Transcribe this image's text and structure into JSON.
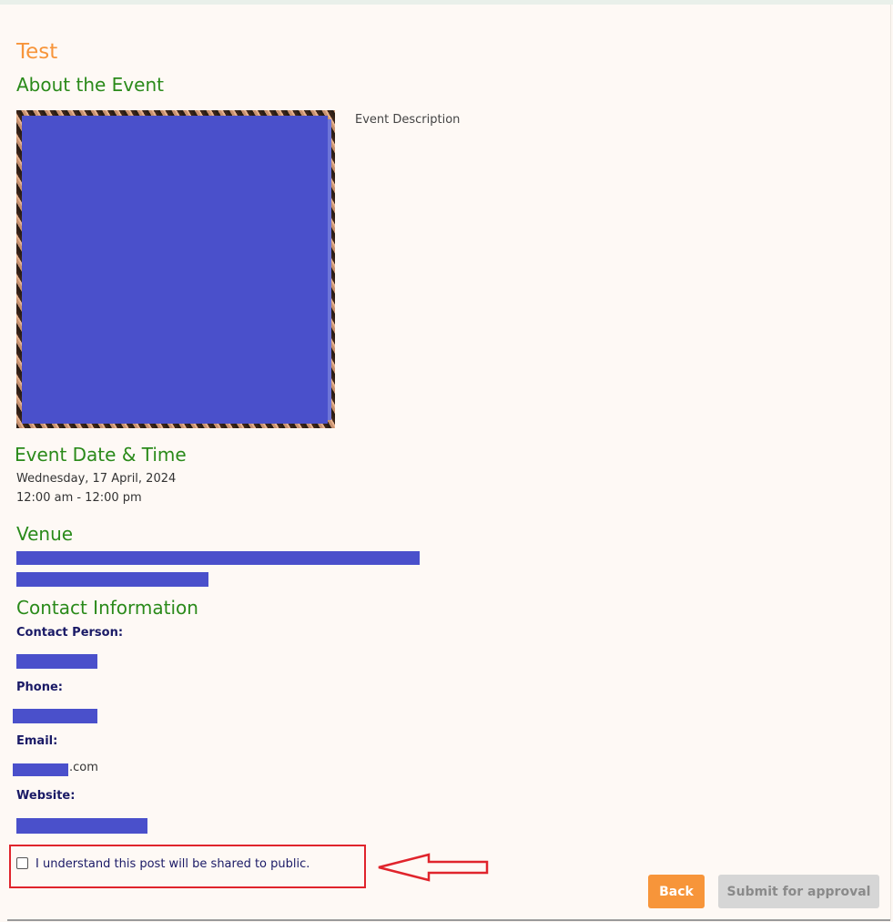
{
  "event": {
    "title": "Test",
    "about_heading": "About the Event",
    "description": "Event Description",
    "datetime_heading": "Event Date & Time",
    "date": "Wednesday, 17 April, 2024",
    "time": "12:00 am - 12:00 pm",
    "venue_heading": "Venue"
  },
  "contact": {
    "heading": "Contact Information",
    "person_label": "Contact Person:",
    "phone_label": "Phone:",
    "email_label": "Email:",
    "email_suffix": ".com",
    "website_label": "Website:"
  },
  "consent": {
    "label": "I understand this post will be shared to public.",
    "checked": false
  },
  "actions": {
    "back_label": "Back",
    "submit_label": "Submit for approval"
  },
  "colors": {
    "title": "#f7953a",
    "heading": "#2a8a1a",
    "redaction": "#4a50cb",
    "annotation": "#e0242c",
    "back_button": "#f7953a",
    "submit_button_disabled": "#d6d6d6"
  },
  "icons": {
    "annotation_arrow": "left-arrow-icon"
  }
}
